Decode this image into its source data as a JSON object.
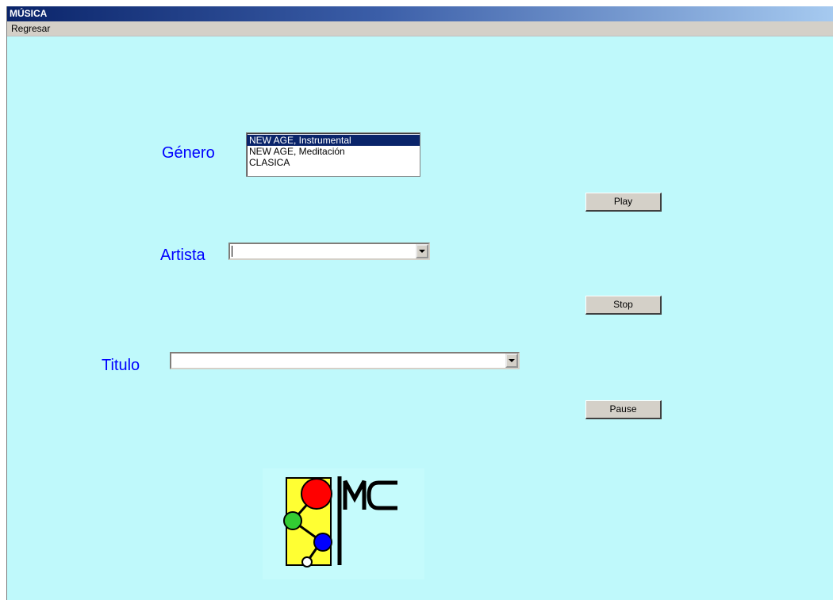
{
  "window": {
    "title": "MÚSICA"
  },
  "menu": {
    "items": [
      {
        "label": "Regresar"
      }
    ]
  },
  "form": {
    "genero_label": "Género",
    "artista_label": "Artista",
    "titulo_label": "Titulo",
    "genero_options": [
      {
        "label": "NEW AGE, Instrumental",
        "selected": true
      },
      {
        "label": "NEW AGE, Meditación",
        "selected": false
      },
      {
        "label": "CLASICA",
        "selected": false
      }
    ],
    "artista_value": "",
    "titulo_value": ""
  },
  "buttons": {
    "play": "Play",
    "stop": "Stop",
    "pause": "Pause"
  },
  "logo": {
    "text": "MC",
    "icon": "mc-logo-icon"
  },
  "colors": {
    "background": "#bff9fb",
    "label": "#0000ff",
    "selection": "#0a246a",
    "logo_bar": "#ffff33",
    "logo_red": "#ff0000",
    "logo_green": "#33cc33",
    "logo_blue": "#0000ff"
  }
}
